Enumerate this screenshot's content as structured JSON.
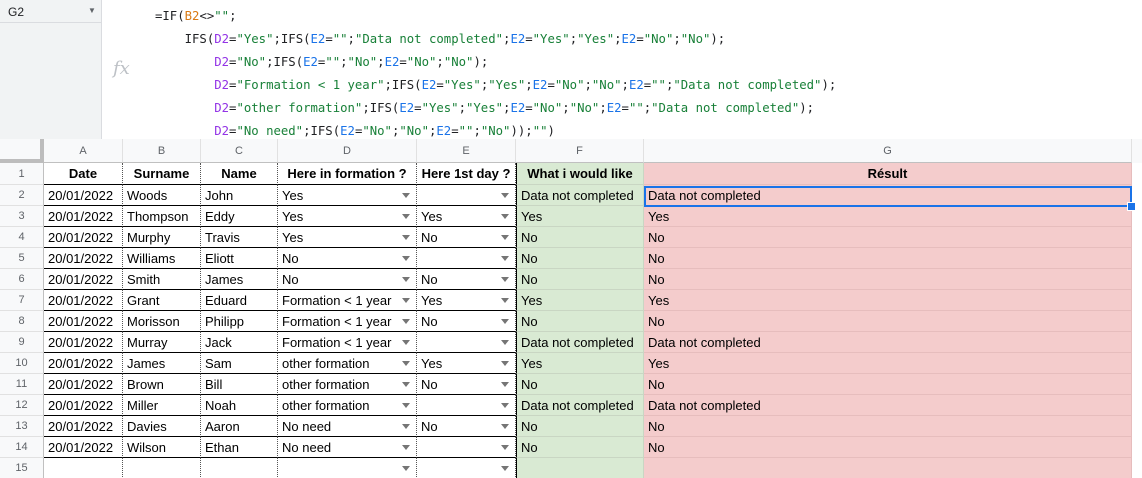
{
  "name_box": {
    "cell_ref": "G2"
  },
  "formula_bar": {
    "fx_label": "fx",
    "lines": [
      [
        [
          "p",
          "=IF("
        ],
        [
          "r1",
          "B2"
        ],
        [
          "p",
          "<>"
        ],
        [
          "s",
          "\"\""
        ],
        [
          "p",
          ";"
        ]
      ],
      [
        [
          "p",
          "    IFS("
        ],
        [
          "r3",
          "D2"
        ],
        [
          "p",
          "="
        ],
        [
          "s",
          "\"Yes\""
        ],
        [
          "p",
          ";IFS("
        ],
        [
          "r2",
          "E2"
        ],
        [
          "p",
          "="
        ],
        [
          "s",
          "\"\""
        ],
        [
          "p",
          ";"
        ],
        [
          "s",
          "\"Data not completed\""
        ],
        [
          "p",
          ";"
        ],
        [
          "r2",
          "E2"
        ],
        [
          "p",
          "="
        ],
        [
          "s",
          "\"Yes\""
        ],
        [
          "p",
          ";"
        ],
        [
          "s",
          "\"Yes\""
        ],
        [
          "p",
          ";"
        ],
        [
          "r2",
          "E2"
        ],
        [
          "p",
          "="
        ],
        [
          "s",
          "\"No\""
        ],
        [
          "p",
          ";"
        ],
        [
          "s",
          "\"No\""
        ],
        [
          "p",
          ");"
        ]
      ],
      [
        [
          "p",
          "        "
        ],
        [
          "r3",
          "D2"
        ],
        [
          "p",
          "="
        ],
        [
          "s",
          "\"No\""
        ],
        [
          "p",
          ";IFS("
        ],
        [
          "r2",
          "E2"
        ],
        [
          "p",
          "="
        ],
        [
          "s",
          "\"\""
        ],
        [
          "p",
          ";"
        ],
        [
          "s",
          "\"No\""
        ],
        [
          "p",
          ";"
        ],
        [
          "r2",
          "E2"
        ],
        [
          "p",
          "="
        ],
        [
          "s",
          "\"No\""
        ],
        [
          "p",
          ";"
        ],
        [
          "s",
          "\"No\""
        ],
        [
          "p",
          ");"
        ]
      ],
      [
        [
          "p",
          "        "
        ],
        [
          "r3",
          "D2"
        ],
        [
          "p",
          "="
        ],
        [
          "s",
          "\"Formation < 1 year\""
        ],
        [
          "p",
          ";IFS("
        ],
        [
          "r2",
          "E2"
        ],
        [
          "p",
          "="
        ],
        [
          "s",
          "\"Yes\""
        ],
        [
          "p",
          ";"
        ],
        [
          "s",
          "\"Yes\""
        ],
        [
          "p",
          ";"
        ],
        [
          "r2",
          "E2"
        ],
        [
          "p",
          "="
        ],
        [
          "s",
          "\"No\""
        ],
        [
          "p",
          ";"
        ],
        [
          "s",
          "\"No\""
        ],
        [
          "p",
          ";"
        ],
        [
          "r2",
          "E2"
        ],
        [
          "p",
          "="
        ],
        [
          "s",
          "\"\""
        ],
        [
          "p",
          ";"
        ],
        [
          "s",
          "\"Data not completed\""
        ],
        [
          "p",
          ");"
        ]
      ],
      [
        [
          "p",
          "        "
        ],
        [
          "r3",
          "D2"
        ],
        [
          "p",
          "="
        ],
        [
          "s",
          "\"other formation\""
        ],
        [
          "p",
          ";IFS("
        ],
        [
          "r2",
          "E2"
        ],
        [
          "p",
          "="
        ],
        [
          "s",
          "\"Yes\""
        ],
        [
          "p",
          ";"
        ],
        [
          "s",
          "\"Yes\""
        ],
        [
          "p",
          ";"
        ],
        [
          "r2",
          "E2"
        ],
        [
          "p",
          "="
        ],
        [
          "s",
          "\"No\""
        ],
        [
          "p",
          ";"
        ],
        [
          "s",
          "\"No\""
        ],
        [
          "p",
          ";"
        ],
        [
          "r2",
          "E2"
        ],
        [
          "p",
          "="
        ],
        [
          "s",
          "\"\""
        ],
        [
          "p",
          ";"
        ],
        [
          "s",
          "\"Data not completed\""
        ],
        [
          "p",
          ");"
        ]
      ],
      [
        [
          "p",
          "        "
        ],
        [
          "r3",
          "D2"
        ],
        [
          "p",
          "="
        ],
        [
          "s",
          "\"No need\""
        ],
        [
          "p",
          ";IFS("
        ],
        [
          "r2",
          "E2"
        ],
        [
          "p",
          "="
        ],
        [
          "s",
          "\"No\""
        ],
        [
          "p",
          ";"
        ],
        [
          "s",
          "\"No\""
        ],
        [
          "p",
          ";"
        ],
        [
          "r2",
          "E2"
        ],
        [
          "p",
          "="
        ],
        [
          "s",
          "\"\""
        ],
        [
          "p",
          ";"
        ],
        [
          "s",
          "\"No\""
        ],
        [
          "p",
          "));"
        ],
        [
          "s",
          "\"\""
        ],
        [
          "p",
          ")"
        ]
      ]
    ]
  },
  "columns": [
    "A",
    "B",
    "C",
    "D",
    "E",
    "F",
    "G"
  ],
  "header_row": {
    "number": "1",
    "labels": [
      "Date",
      "Surname",
      "Name",
      "Here in formation ?",
      "Here 1st day ?",
      "What i would like",
      "Résult"
    ]
  },
  "rows": [
    {
      "n": "2",
      "date": "20/01/2022",
      "surname": "Woods",
      "name": "John",
      "formation": "Yes",
      "first_day": "",
      "would_like": "Data not completed",
      "result": "Data not completed"
    },
    {
      "n": "3",
      "date": "20/01/2022",
      "surname": "Thompson",
      "name": "Eddy",
      "formation": "Yes",
      "first_day": "Yes",
      "would_like": "Yes",
      "result": "Yes"
    },
    {
      "n": "4",
      "date": "20/01/2022",
      "surname": "Murphy",
      "name": "Travis",
      "formation": "Yes",
      "first_day": "No",
      "would_like": "No",
      "result": "No"
    },
    {
      "n": "5",
      "date": "20/01/2022",
      "surname": "Williams",
      "name": "Eliott",
      "formation": "No",
      "first_day": "",
      "would_like": "No",
      "result": "No"
    },
    {
      "n": "6",
      "date": "20/01/2022",
      "surname": "Smith",
      "name": "James",
      "formation": "No",
      "first_day": "No",
      "would_like": "No",
      "result": "No"
    },
    {
      "n": "7",
      "date": "20/01/2022",
      "surname": "Grant",
      "name": "Eduard",
      "formation": "Formation < 1 year",
      "first_day": "Yes",
      "would_like": "Yes",
      "result": "Yes"
    },
    {
      "n": "8",
      "date": "20/01/2022",
      "surname": "Morisson",
      "name": "Philipp",
      "formation": "Formation < 1 year",
      "first_day": "No",
      "would_like": "No",
      "result": "No"
    },
    {
      "n": "9",
      "date": "20/01/2022",
      "surname": "Murray",
      "name": "Jack",
      "formation": "Formation < 1 year",
      "first_day": "",
      "would_like": "Data not completed",
      "result": "Data not completed"
    },
    {
      "n": "10",
      "date": "20/01/2022",
      "surname": "James",
      "name": "Sam",
      "formation": "other formation",
      "first_day": "Yes",
      "would_like": "Yes",
      "result": "Yes"
    },
    {
      "n": "11",
      "date": "20/01/2022",
      "surname": "Brown",
      "name": "Bill",
      "formation": "other formation",
      "first_day": "No",
      "would_like": "No",
      "result": "No"
    },
    {
      "n": "12",
      "date": "20/01/2022",
      "surname": "Miller",
      "name": "Noah",
      "formation": "other formation",
      "first_day": "",
      "would_like": "Data not completed",
      "result": "Data not completed"
    },
    {
      "n": "13",
      "date": "20/01/2022",
      "surname": "Davies",
      "name": "Aaron",
      "formation": "No need",
      "first_day": "No",
      "would_like": "No",
      "result": "No"
    },
    {
      "n": "14",
      "date": "20/01/2022",
      "surname": "Wilson",
      "name": "Ethan",
      "formation": "No need",
      "first_day": "",
      "would_like": "No",
      "result": "No"
    },
    {
      "n": "15",
      "date": "",
      "surname": "",
      "name": "",
      "formation": "",
      "first_day": "",
      "would_like": "",
      "result": ""
    }
  ],
  "colors": {
    "what_i_would_like_fill": "#d9ead3",
    "result_fill": "#f4cccc",
    "selection": "#1a73e8",
    "formula_string": "#188038"
  },
  "icons": [
    "dropdown-arrow-icon",
    "fx-icon",
    "namebox-dropdown-icon"
  ]
}
